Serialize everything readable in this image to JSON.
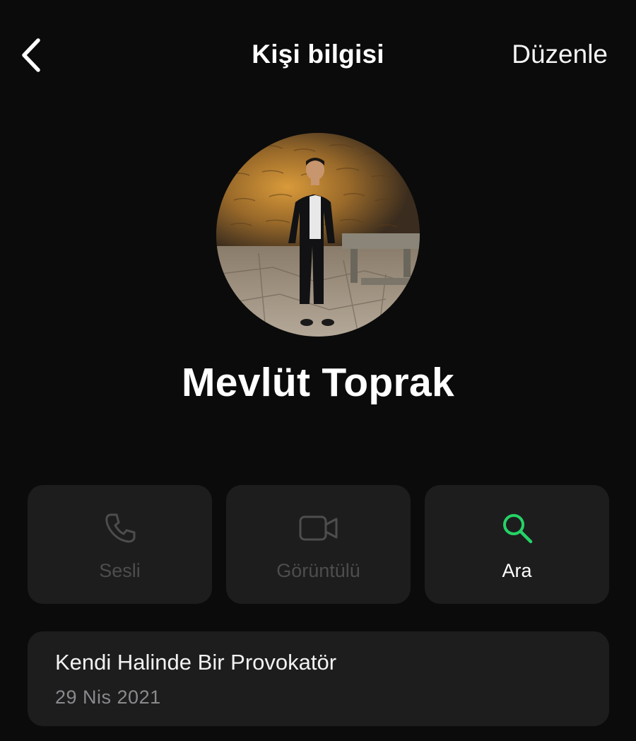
{
  "header": {
    "title": "Kişi bilgisi",
    "edit_label": "Düzenle"
  },
  "contact": {
    "name": "Mevlüt Toprak"
  },
  "actions": [
    {
      "label": "Sesli",
      "icon": "phone-icon",
      "enabled": false
    },
    {
      "label": "Görüntülü",
      "icon": "video-camera-icon",
      "enabled": false
    },
    {
      "label": "Ara",
      "icon": "search-icon",
      "enabled": true
    }
  ],
  "about": {
    "text": "Kendi Halinde Bir Provokatör",
    "date": "29 Nis 2021"
  },
  "colors": {
    "background": "#0b0b0b",
    "tile": "#1d1d1e",
    "accent_green": "#25d366",
    "disabled_gray": "#4d4d4f",
    "secondary_text": "#8a8a8e"
  }
}
